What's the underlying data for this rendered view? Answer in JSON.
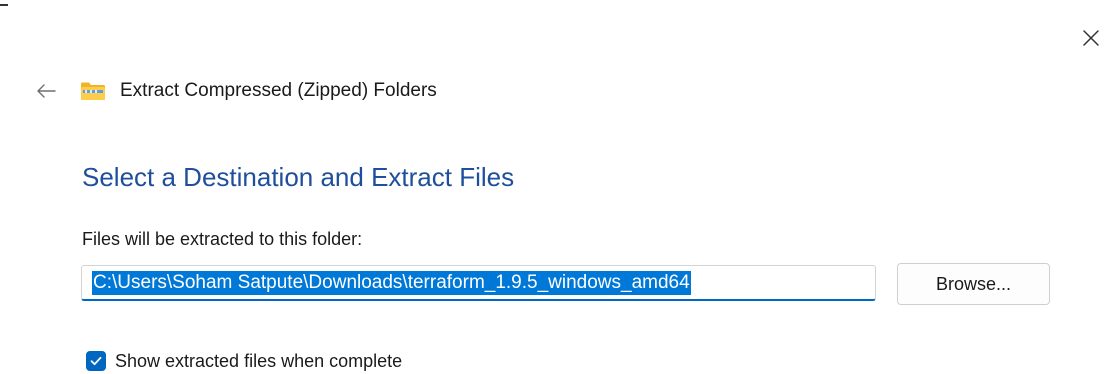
{
  "dialog": {
    "window_title": "Extract Compressed (Zipped) Folders",
    "heading": "Select a Destination and Extract Files",
    "destination_label": "Files will be extracted to this folder:",
    "destination_path": "C:\\Users\\Soham Satpute\\Downloads\\terraform_1.9.5_windows_amd64",
    "browse_label": "Browse...",
    "show_files_label": "Show extracted files when complete",
    "show_files_checked": true
  },
  "icons": {
    "close": "close-icon",
    "back": "back-arrow-icon",
    "folder": "zip-folder-icon",
    "check": "checkmark-icon"
  },
  "colors": {
    "heading": "#1f4e9c",
    "accent": "#0067c0",
    "selection": "#0078d7"
  }
}
